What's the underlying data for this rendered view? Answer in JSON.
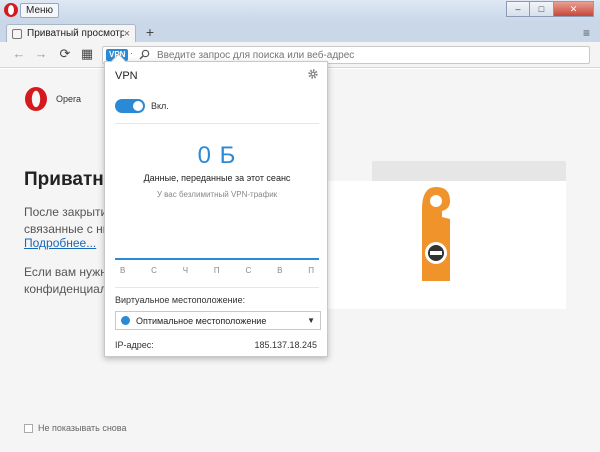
{
  "window": {
    "menu_label": "Меню",
    "controls": {
      "minimize": "–",
      "maximize": "□",
      "close": "✕"
    }
  },
  "tabs": [
    {
      "title": "Приватный просмотр",
      "close": "×"
    }
  ],
  "tabstrip": {
    "new_tab": "+",
    "menu_icon": "≡"
  },
  "toolbar": {
    "back": "←",
    "forward": "→",
    "reload": "⟳",
    "speed_dial": "▦",
    "vpn_badge": "VPN",
    "address_dot": "·",
    "address_placeholder": "Введите запрос для поиска или веб-адрес"
  },
  "page": {
    "logo_text": "Opera",
    "heading": "Приватный просмотр",
    "para1_line1": "После закрытия",
    "para1_line2": "связанные с ним",
    "link": "Подробнее...",
    "para2_line1": "Если вам нужно",
    "para2_line2": "конфиденциаль",
    "dont_show": "Не показывать снова"
  },
  "vpn_popup": {
    "title": "VPN",
    "toggle_label": "Вкл.",
    "toggle_on": true,
    "data_amount": "0 Б",
    "data_caption": "Данные, переданные за этот сеанс",
    "data_sub": "У вас безлимитный VPN-трафик",
    "days": [
      "В",
      "С",
      "Ч",
      "П",
      "С",
      "В",
      "П"
    ],
    "location_label": "Виртуальное местоположение:",
    "location_value": "Оптимальное местоположение",
    "ip_label": "IP-адрес:",
    "ip_value": "185.137.18.245"
  },
  "colors": {
    "accent": "#2b8ad6",
    "opera_red": "#d41a1f",
    "hanger_orange": "#f0932b"
  }
}
